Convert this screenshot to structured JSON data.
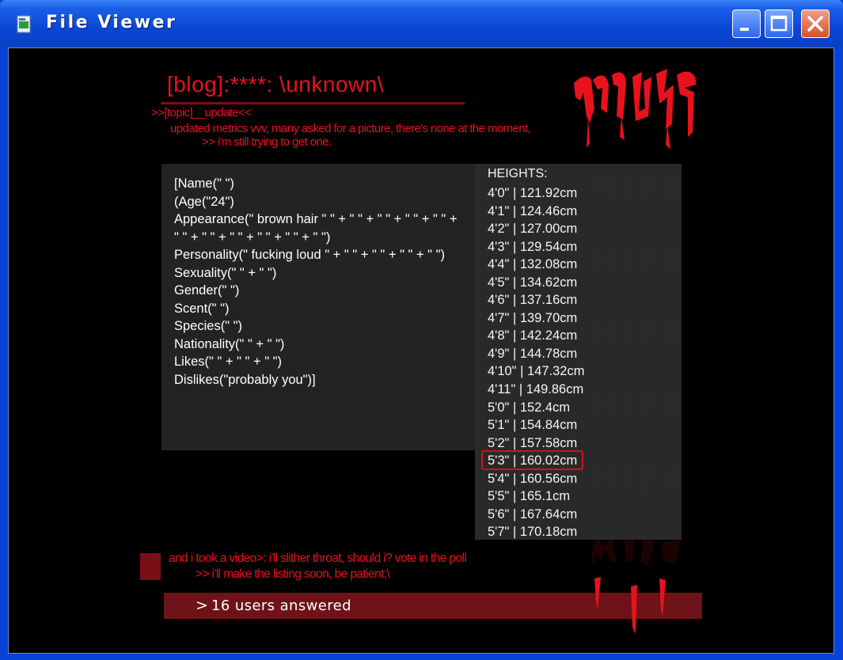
{
  "window": {
    "title": "File Viewer",
    "icon": "file-viewer-icon"
  },
  "header": {
    "blog_title": "[blog]:****: \\unknown\\",
    "topic": ">>[topic]__update<<",
    "update_text": "updated metrics vvv, many asked for a picture, there's none at the moment,",
    "trying_text": ">> i'm still trying to get one.",
    "logo_text": "muse"
  },
  "profile": {
    "lines": [
      "[Name(\" \")",
      "(Age(\"24\")",
      "Appearance(\" brown hair \" \" + \" \" + \" \" + \" \" + \" \" +",
      "\" \" + \" \" + \" \" + \" \" + \" \" + \" \")",
      "Personality(\" fucking loud \" + \" \" + \" \" + \" \" + \" \")",
      "Sexuality(\" \" + \" \")",
      "Gender(\" \")",
      "Scent(\" \")",
      "Species(\" \")",
      "Nationality(\" \" + \" \")",
      "Likes(\" \" + \" \" + \" \")",
      "Dislikes(\"probably you\")]"
    ]
  },
  "heights": {
    "header": "HEIGHTS:",
    "rows": [
      "4'0\" | 121.92cm",
      "4'1\" | 124.46cm",
      "4'2\" | 127.00cm",
      "4'3\" | 129.54cm",
      "4'4\" | 132.08cm",
      "4'5\" | 134.62cm",
      "4'6\" | 137.16cm",
      "4'7\" | 139.70cm",
      "4'8\" | 142.24cm",
      "4'9\" | 144.78cm",
      "4'10\" | 147.32cm",
      "4'11\" | 149.86cm",
      "5'0\" | 152.4cm",
      "5'1\" | 154.84cm",
      "5'2\" | 157.58cm",
      "5'3\" | 160.02cm",
      "5'4\" | 160.56cm",
      "5'5\" | 165.1cm",
      "5'6\" | 167.64cm",
      "5'7\" | 170.18cm"
    ],
    "selected": "5'3\" | 160.02cm"
  },
  "footer": {
    "video_text": "and i took a video>: i'll slither throat, should i? vote in the poll",
    "listing_text": ">> i'll make the listing soon, be patient;\\",
    "poll_chevron": ">",
    "poll_count": "16 users answered"
  },
  "colors": {
    "accent_red": "#e8121c",
    "dark_red": "#6e1318",
    "panel_bg": "#232326",
    "titlebar_blue": "#0b47d4"
  }
}
